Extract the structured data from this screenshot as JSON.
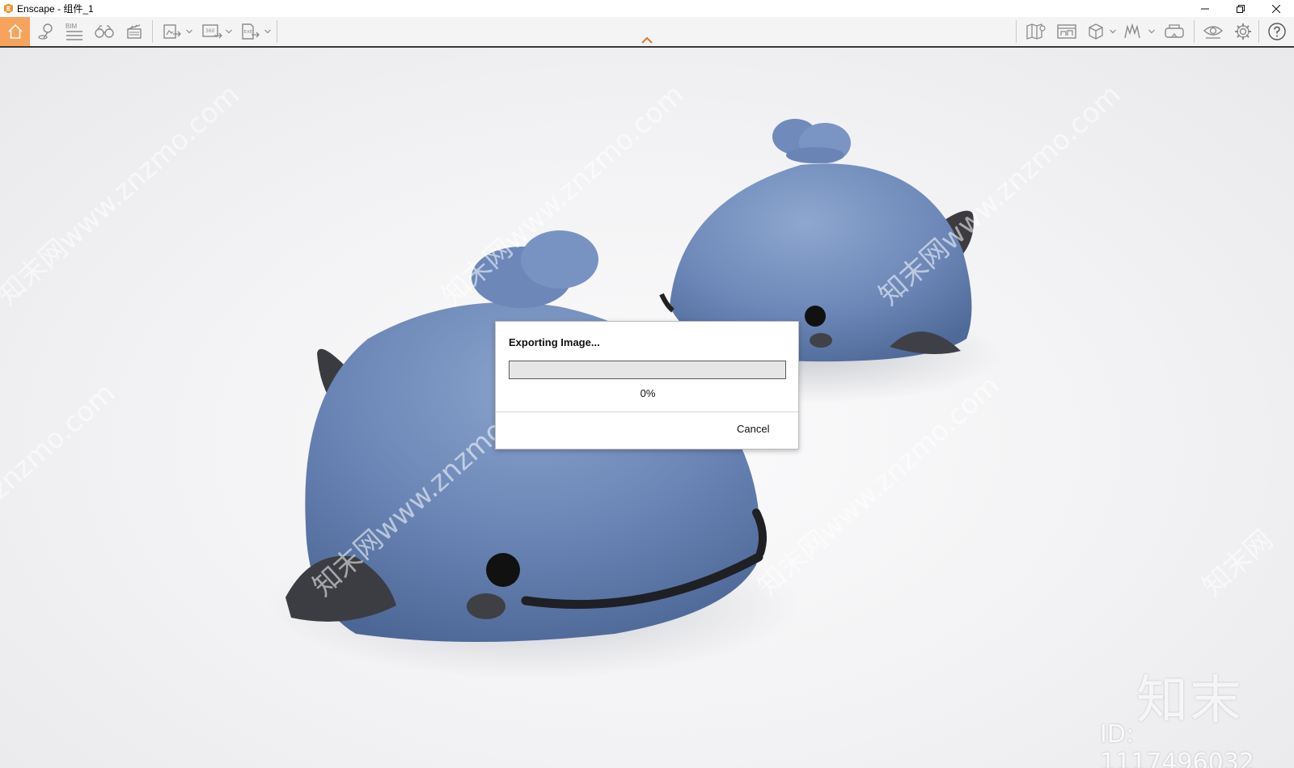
{
  "window": {
    "title": "Enscape - 组件_1"
  },
  "toolbar": {
    "bim_label": "BIM"
  },
  "dialog": {
    "title": "Exporting Image...",
    "progress_percent": 0,
    "progress_label": "0%",
    "cancel_label": "Cancel"
  },
  "watermark": {
    "logo_text": "知末",
    "id_text": "ID: 1117496032"
  },
  "colors": {
    "accent_home": "#f7a35c",
    "collapse_chevron": "#e07a2a"
  },
  "icons": {
    "left": [
      "home-icon",
      "location-pin-icon",
      "bim-list-icon",
      "binoculars-icon",
      "clapperboard-icon",
      "screenshot-export-icon",
      "panorama-360-icon",
      "exe-export-icon"
    ],
    "right": [
      "map-icon",
      "asset-library-icon",
      "cube-view-icon",
      "material-icon",
      "vr-headset-icon",
      "visibility-icon",
      "settings-gear-icon",
      "help-icon"
    ]
  }
}
